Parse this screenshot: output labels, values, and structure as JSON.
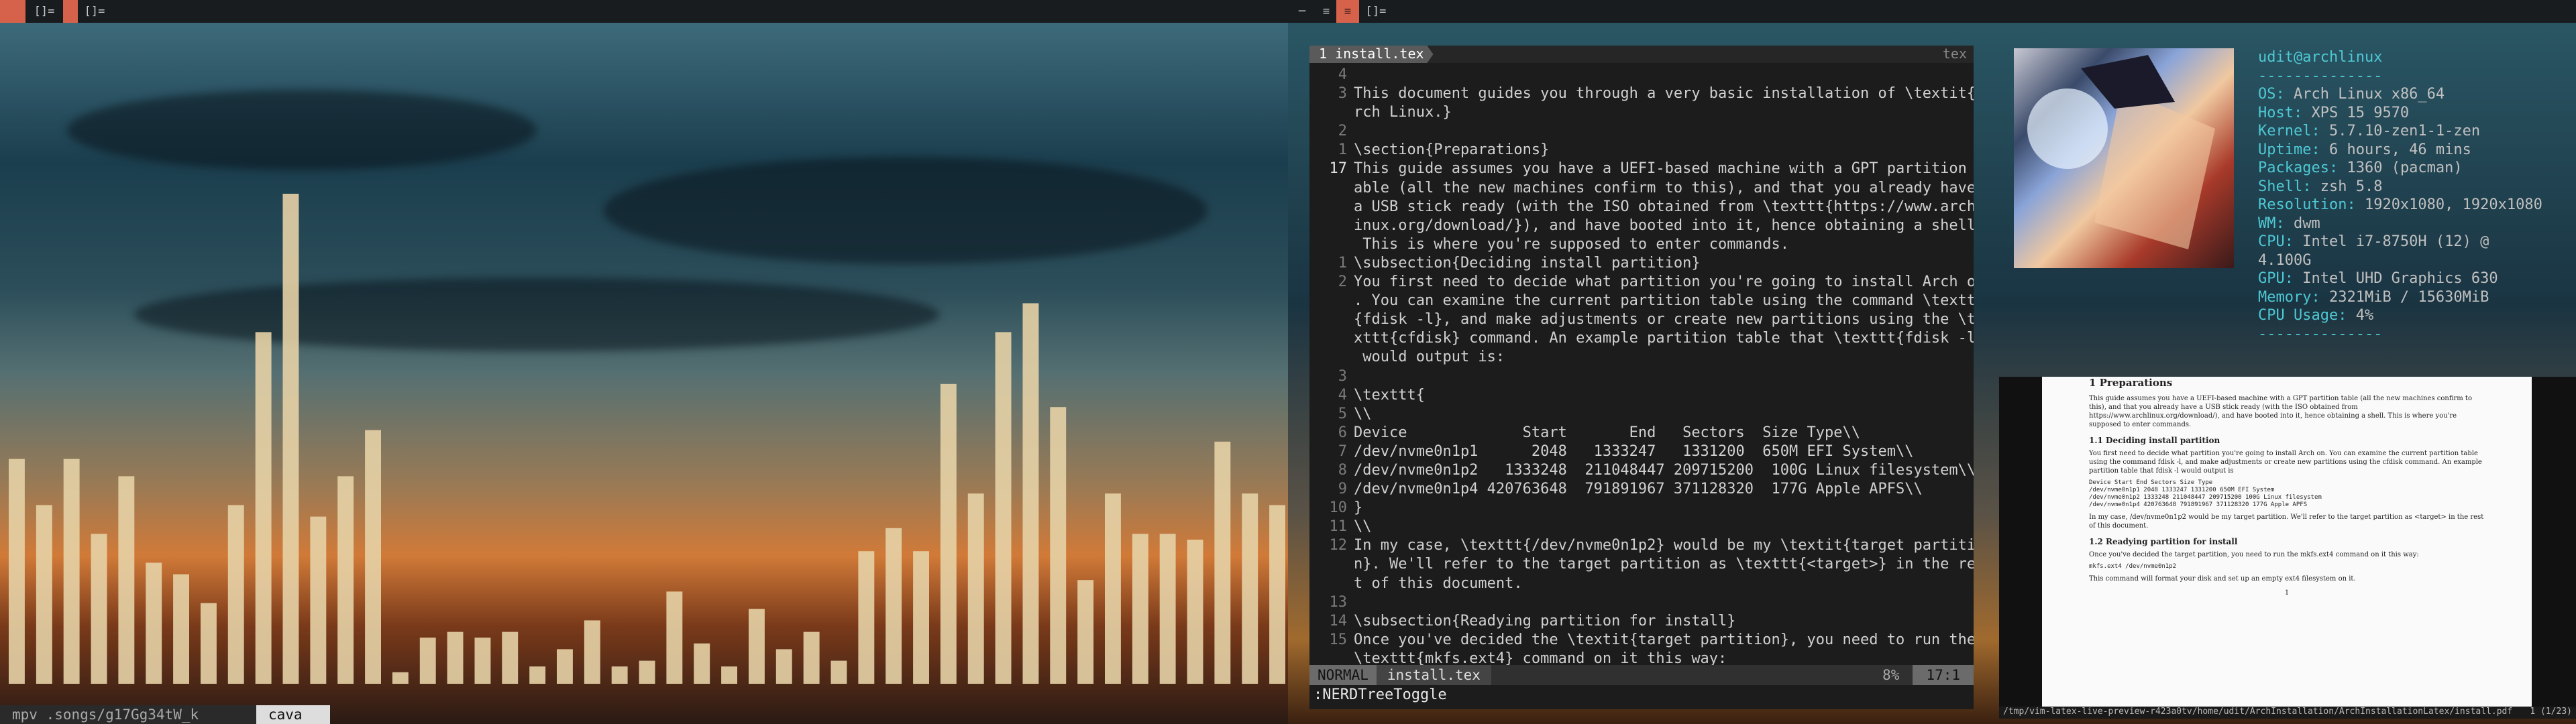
{
  "left_bar": {
    "tags": [
      "",
      "[]=",
      "[]="
    ]
  },
  "right_bar": {
    "tags": [
      "",
      "",
      "",
      "[]="
    ]
  },
  "left_status": {
    "mpv": "mpv .songs/g17Gg34tW_k",
    "cava": "cava"
  },
  "cava_levels": [
    0.39,
    0.31,
    0.39,
    0.26,
    0.36,
    0.21,
    0.19,
    0.14,
    0.31,
    0.61,
    0.85,
    0.29,
    0.36,
    0.44,
    0.02,
    0.08,
    0.09,
    0.08,
    0.09,
    0.03,
    0.06,
    0.11,
    0.03,
    0.04,
    0.16,
    0.07,
    0.03,
    0.13,
    0.06,
    0.09,
    0.04,
    0.23,
    0.27,
    0.23,
    0.52,
    0.33,
    0.61,
    0.66,
    0.48,
    0.18,
    0.33,
    0.26,
    0.26,
    0.25,
    0.42,
    0.33,
    0.31
  ],
  "vim": {
    "tab_name": "1 install.tex",
    "tab_type": "tex",
    "lines": [
      {
        "n": "4",
        "t": ""
      },
      {
        "n": "3",
        "t": "This document guides you through a very basic installation of \\textit{A"
      },
      {
        "n": "",
        "t": "rch Linux.}"
      },
      {
        "n": "2",
        "t": ""
      },
      {
        "n": "1",
        "t": "\\section{Preparations}"
      },
      {
        "n": "17",
        "t": "This guide assumes you have a UEFI-based machine with a GPT partition t",
        "cur": true
      },
      {
        "n": "",
        "t": "able (all the new machines confirm to this), and that you already have"
      },
      {
        "n": "",
        "t": "a USB stick ready (with the ISO obtained from \\texttt{https://www.archl"
      },
      {
        "n": "",
        "t": "inux.org/download/}), and have booted into it, hence obtaining a shell."
      },
      {
        "n": "",
        "t": " This is where you're supposed to enter commands."
      },
      {
        "n": "1",
        "t": "\\subsection{Deciding install partition}"
      },
      {
        "n": "2",
        "t": "You first need to decide what partition you're going to install Arch on"
      },
      {
        "n": "",
        "t": ". You can examine the current partition table using the command \\texttt"
      },
      {
        "n": "",
        "t": "{fdisk -l}, and make adjustments or create new partitions using the \\te"
      },
      {
        "n": "",
        "t": "xttt{cfdisk} command. An example partition table that \\texttt{fdisk -l}"
      },
      {
        "n": "",
        "t": " would output is:"
      },
      {
        "n": "3",
        "t": ""
      },
      {
        "n": "4",
        "t": "\\texttt{"
      },
      {
        "n": "5",
        "t": "\\\\"
      },
      {
        "n": "6",
        "t": "Device             Start       End   Sectors  Size Type\\\\"
      },
      {
        "n": "7",
        "t": "/dev/nvme0n1p1      2048   1333247   1331200  650M EFI System\\\\"
      },
      {
        "n": "8",
        "t": "/dev/nvme0n1p2   1333248  211048447 209715200  100G Linux filesystem\\\\"
      },
      {
        "n": "9",
        "t": "/dev/nvme0n1p4 420763648  791891967 371128320  177G Apple APFS\\\\"
      },
      {
        "n": "10",
        "t": "}"
      },
      {
        "n": "11",
        "t": "\\\\"
      },
      {
        "n": "12",
        "t": "In my case, \\texttt{/dev/nvme0n1p2} would be my \\textit{target partitio"
      },
      {
        "n": "",
        "t": "n}. We'll refer to the target partition as \\texttt{<target>} in the res"
      },
      {
        "n": "",
        "t": "t of this document."
      },
      {
        "n": "13",
        "t": ""
      },
      {
        "n": "14",
        "t": "\\subsection{Readying partition for install}"
      },
      {
        "n": "15",
        "t": "Once you've decided the \\textit{target partition}, you need to run the"
      },
      {
        "n": "",
        "t": "\\texttt{mkfs.ext4} command on it this way:"
      }
    ],
    "mode": "NORMAL",
    "file": "install.tex",
    "percent": "8%",
    "position": "17:1",
    "command": ":NERDTreeToggle"
  },
  "fetch": {
    "title": "udit@archlinux",
    "sep": "--------------",
    "sep2": "--------------",
    "rows": [
      {
        "k": "OS:",
        "v": "Arch Linux x86_64"
      },
      {
        "k": "Host:",
        "v": "XPS 15 9570"
      },
      {
        "k": "Kernel:",
        "v": "5.7.10-zen1-1-zen"
      },
      {
        "k": "Uptime:",
        "v": "6 hours, 46 mins"
      },
      {
        "k": "Packages:",
        "v": "1360 (pacman)"
      },
      {
        "k": "Shell:",
        "v": "zsh 5.8"
      },
      {
        "k": "Resolution:",
        "v": "1920x1080, 1920x1080"
      },
      {
        "k": "WM:",
        "v": "dwm"
      },
      {
        "k": "CPU:",
        "v": "Intel i7-8750H (12) @ 4.100G"
      },
      {
        "k": "GPU:",
        "v": "Intel UHD Graphics 630"
      },
      {
        "k": "Memory:",
        "v": "2321MiB / 15630MiB"
      },
      {
        "k": "CPU Usage:",
        "v": "4%"
      }
    ]
  },
  "pdf": {
    "h1": "1   Preparations",
    "p1": "This guide assumes you have a UEFI-based machine with a GPT partition table (all the new machines confirm to this), and that you already have a USB stick ready (with the ISO obtained from https://www.archlinux.org/download/), and have booted into it, hence obtaining a shell. This is where you're supposed to enter commands.",
    "h2": "1.1   Deciding install partition",
    "p2": "You first need to decide what partition you're going to install Arch on. You can examine the current partition table using the command fdisk -l, and make adjustments or create new partitions using the cfdisk command. An example partition table that fdisk -l would output is",
    "pre": "Device Start End Sectors Size Type\n/dev/nvme0n1p1 2048 1333247 1331200 650M EFI System\n/dev/nvme0n1p2 1333248 211048447 209715200 100G Linux filesystem\n/dev/nvme0n1p4 420763648 791891967 371128320 177G Apple APFS",
    "p3": "In my case, /dev/nvme0n1p2 would be my target partition. We'll refer to the target partition as <target> in the rest of this document.",
    "h3": "1.2   Readying partition for install",
    "p4": "Once you've decided the target partition, you need to run the mkfs.ext4 command on it this way:",
    "pre2": "mkfs.ext4 /dev/nvme0n1p2",
    "p5": "This command will format your disk and set up an empty ext4 filesystem on it.",
    "page_no": "1",
    "path": "/tmp/vim-latex-live-preview-r423a0tv/home/udit/ArchInstallation/ArchInstallationLatex/install.pdf",
    "pages": "1 (1/23)"
  }
}
